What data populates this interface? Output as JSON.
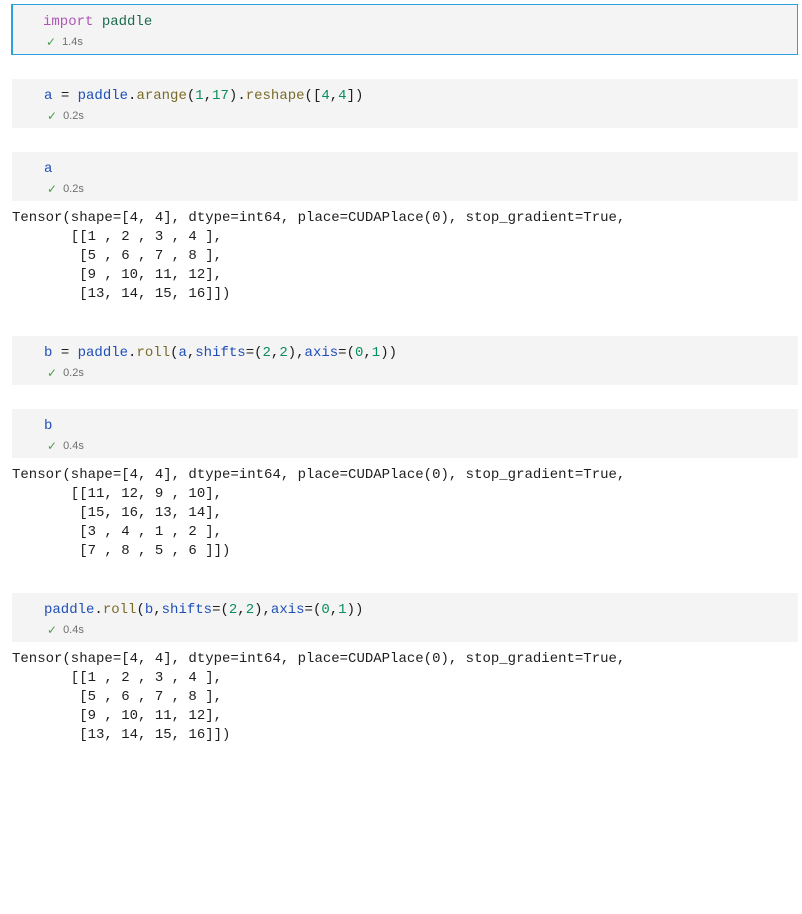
{
  "cells": [
    {
      "selected": true,
      "code_tokens": [
        [
          {
            "t": "import",
            "c": "tok-kw"
          },
          {
            "t": " ",
            "c": ""
          },
          {
            "t": "paddle",
            "c": "tok-mod"
          }
        ]
      ],
      "exec_time": "1.4s",
      "output": null
    },
    {
      "selected": false,
      "code_tokens": [
        [
          {
            "t": "a",
            "c": "tok-var"
          },
          {
            "t": " ",
            "c": ""
          },
          {
            "t": "=",
            "c": ""
          },
          {
            "t": " ",
            "c": ""
          },
          {
            "t": "paddle",
            "c": "tok-var"
          },
          {
            "t": ".",
            "c": ""
          },
          {
            "t": "arange",
            "c": "tok-fn"
          },
          {
            "t": "(",
            "c": ""
          },
          {
            "t": "1",
            "c": "tok-num"
          },
          {
            "t": ",",
            "c": ""
          },
          {
            "t": "17",
            "c": "tok-num"
          },
          {
            "t": ")",
            "c": ""
          },
          {
            "t": ".",
            "c": ""
          },
          {
            "t": "reshape",
            "c": "tok-fn"
          },
          {
            "t": "(",
            "c": ""
          },
          {
            "t": "[",
            "c": ""
          },
          {
            "t": "4",
            "c": "tok-num"
          },
          {
            "t": ",",
            "c": ""
          },
          {
            "t": "4",
            "c": "tok-num"
          },
          {
            "t": "]",
            "c": ""
          },
          {
            "t": ")",
            "c": ""
          }
        ]
      ],
      "exec_time": "0.2s",
      "output": null
    },
    {
      "selected": false,
      "code_tokens": [
        [
          {
            "t": "a",
            "c": "tok-var"
          }
        ]
      ],
      "exec_time": "0.2s",
      "output": "Tensor(shape=[4, 4], dtype=int64, place=CUDAPlace(0), stop_gradient=True,\n       [[1 , 2 , 3 , 4 ],\n        [5 , 6 , 7 , 8 ],\n        [9 , 10, 11, 12],\n        [13, 14, 15, 16]])"
    },
    {
      "selected": false,
      "code_tokens": [
        [
          {
            "t": "b",
            "c": "tok-var"
          },
          {
            "t": " ",
            "c": ""
          },
          {
            "t": "=",
            "c": ""
          },
          {
            "t": " ",
            "c": ""
          },
          {
            "t": "paddle",
            "c": "tok-var"
          },
          {
            "t": ".",
            "c": ""
          },
          {
            "t": "roll",
            "c": "tok-fn"
          },
          {
            "t": "(",
            "c": ""
          },
          {
            "t": "a",
            "c": "tok-var"
          },
          {
            "t": ",",
            "c": ""
          },
          {
            "t": "shifts",
            "c": "tok-var"
          },
          {
            "t": "=",
            "c": ""
          },
          {
            "t": "(",
            "c": ""
          },
          {
            "t": "2",
            "c": "tok-num"
          },
          {
            "t": ",",
            "c": ""
          },
          {
            "t": "2",
            "c": "tok-num"
          },
          {
            "t": ")",
            "c": ""
          },
          {
            "t": ",",
            "c": ""
          },
          {
            "t": "axis",
            "c": "tok-var"
          },
          {
            "t": "=",
            "c": ""
          },
          {
            "t": "(",
            "c": ""
          },
          {
            "t": "0",
            "c": "tok-num"
          },
          {
            "t": ",",
            "c": ""
          },
          {
            "t": "1",
            "c": "tok-num"
          },
          {
            "t": ")",
            "c": ""
          },
          {
            "t": ")",
            "c": ""
          }
        ]
      ],
      "exec_time": "0.2s",
      "output": null
    },
    {
      "selected": false,
      "code_tokens": [
        [
          {
            "t": "b",
            "c": "tok-var"
          }
        ]
      ],
      "exec_time": "0.4s",
      "output": "Tensor(shape=[4, 4], dtype=int64, place=CUDAPlace(0), stop_gradient=True,\n       [[11, 12, 9 , 10],\n        [15, 16, 13, 14],\n        [3 , 4 , 1 , 2 ],\n        [7 , 8 , 5 , 6 ]])"
    },
    {
      "selected": false,
      "code_tokens": [
        [
          {
            "t": "paddle",
            "c": "tok-var"
          },
          {
            "t": ".",
            "c": ""
          },
          {
            "t": "roll",
            "c": "tok-fn"
          },
          {
            "t": "(",
            "c": ""
          },
          {
            "t": "b",
            "c": "tok-var"
          },
          {
            "t": ",",
            "c": ""
          },
          {
            "t": "shifts",
            "c": "tok-var"
          },
          {
            "t": "=",
            "c": ""
          },
          {
            "t": "(",
            "c": ""
          },
          {
            "t": "2",
            "c": "tok-num"
          },
          {
            "t": ",",
            "c": ""
          },
          {
            "t": "2",
            "c": "tok-num"
          },
          {
            "t": ")",
            "c": ""
          },
          {
            "t": ",",
            "c": ""
          },
          {
            "t": "axis",
            "c": "tok-var"
          },
          {
            "t": "=",
            "c": ""
          },
          {
            "t": "(",
            "c": ""
          },
          {
            "t": "0",
            "c": "tok-num"
          },
          {
            "t": ",",
            "c": ""
          },
          {
            "t": "1",
            "c": "tok-num"
          },
          {
            "t": ")",
            "c": ""
          },
          {
            "t": ")",
            "c": ""
          }
        ]
      ],
      "exec_time": "0.4s",
      "output": "Tensor(shape=[4, 4], dtype=int64, place=CUDAPlace(0), stop_gradient=True,\n       [[1 , 2 , 3 , 4 ],\n        [5 , 6 , 7 , 8 ],\n        [9 , 10, 11, 12],\n        [13, 14, 15, 16]])"
    }
  ]
}
